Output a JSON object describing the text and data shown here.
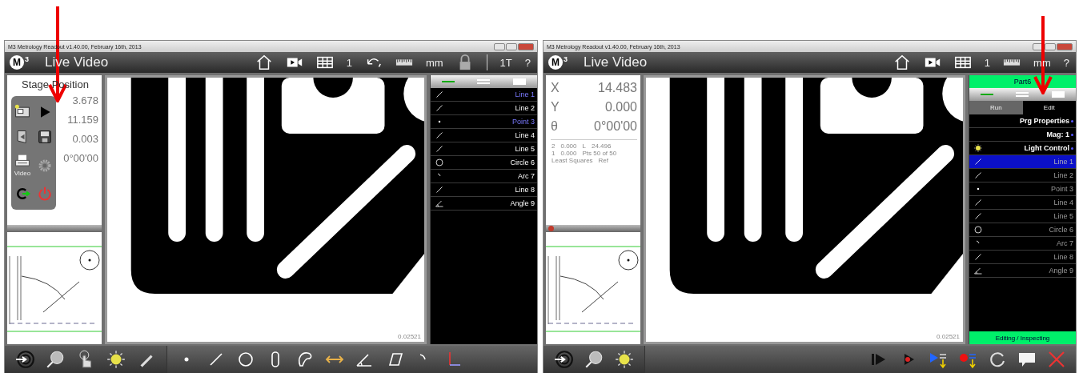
{
  "windows": [
    {
      "title": "M3 Metrology Readout  v1.40.00, February 16th, 2013",
      "logo": {
        "letter": "M",
        "superscript": "3"
      },
      "view_title": "Live Video",
      "header": [
        {
          "kind": "home"
        },
        {
          "kind": "video"
        },
        {
          "kind": "table"
        },
        {
          "kind": "text",
          "text": "1"
        },
        {
          "kind": "skew"
        },
        {
          "kind": "ruler"
        },
        {
          "kind": "text",
          "text": "mm"
        },
        {
          "kind": "lock"
        },
        {
          "kind": "divider"
        },
        {
          "kind": "text",
          "text": "1T"
        },
        {
          "kind": "text",
          "text": "?"
        }
      ],
      "readout": {
        "title": "Stage Position",
        "axes": [
          {
            "value": "3.678"
          },
          {
            "value": "11.159"
          },
          {
            "value": "0.003"
          },
          {
            "value": "0°00'00"
          }
        ]
      },
      "popup_menu": {
        "items": [
          {
            "kind": "display"
          },
          {
            "kind": "play"
          },
          {
            "kind": "door"
          },
          {
            "kind": "disk"
          },
          {
            "kind": "printer",
            "label": "Video"
          },
          {
            "kind": "gear"
          },
          {
            "kind": "restart"
          },
          {
            "kind": "power"
          }
        ]
      },
      "sketch": {
        "recording": false
      },
      "scale": "0.02521",
      "feature_list": {
        "rows": [
          {
            "kind": "line",
            "label": "Line 1",
            "selected": true
          },
          {
            "kind": "line",
            "label": "Line 2",
            "selected": false
          },
          {
            "kind": "point",
            "label": "Point 3",
            "selected": true
          },
          {
            "kind": "line",
            "label": "Line 4",
            "selected": false
          },
          {
            "kind": "line",
            "label": "Line 5",
            "selected": false
          },
          {
            "kind": "circle",
            "label": "Circle 6",
            "selected": false
          },
          {
            "kind": "arc",
            "label": "Arc 7",
            "selected": false
          },
          {
            "kind": "line",
            "label": "Line 8",
            "selected": false
          },
          {
            "kind": "angle",
            "label": "Angle 9",
            "selected": false
          }
        ]
      },
      "toolbar": {
        "primary": [
          {
            "kind": "target"
          },
          {
            "kind": "zoom"
          },
          {
            "kind": "hand"
          },
          {
            "kind": "light"
          },
          {
            "kind": "pencil"
          }
        ],
        "secondary": [
          {
            "kind": "point"
          },
          {
            "kind": "line"
          },
          {
            "kind": "circle"
          },
          {
            "kind": "slot"
          },
          {
            "kind": "blob"
          },
          {
            "kind": "distance"
          },
          {
            "kind": "angle"
          },
          {
            "kind": "parallelogram"
          },
          {
            "kind": "arc"
          },
          {
            "kind": "axes"
          }
        ]
      }
    },
    {
      "title": "M3 Metrology Readout  v1.40.00, February 16th, 2013",
      "logo": {
        "letter": "M",
        "superscript": "3"
      },
      "view_title": "Live Video",
      "header": [
        {
          "kind": "home"
        },
        {
          "kind": "video"
        },
        {
          "kind": "table"
        },
        {
          "kind": "text",
          "text": "1"
        },
        {
          "kind": "ruler"
        },
        {
          "kind": "text",
          "text": "mm"
        },
        {
          "kind": "text",
          "text": "?"
        }
      ],
      "readout": {
        "axes": [
          {
            "label": "X",
            "value": "14.483"
          },
          {
            "label": "Y",
            "value": "0.000"
          },
          {
            "label": "θ",
            "value": "0°00'00"
          }
        ],
        "details": [
          [
            "2",
            "0.000",
            "L",
            "24.496"
          ],
          [
            "1",
            "0.000",
            "Pts 50 of 50"
          ],
          [
            "Least Squares",
            "Ref"
          ]
        ]
      },
      "sketch": {
        "recording": true
      },
      "scale": "0.02521",
      "feature_list": {
        "part": "Part6",
        "tabs": [
          {
            "label": "Run",
            "selected": false
          },
          {
            "label": "Edit",
            "selected": true
          }
        ],
        "rows": [
          {
            "kind": "setting",
            "label": "Prg Properties",
            "selected": false
          },
          {
            "kind": "setting",
            "label": "Mag: 1",
            "selected": false
          },
          {
            "kind": "light",
            "label": "Light Control",
            "selected": false
          },
          {
            "kind": "line",
            "label": "Line 1",
            "selected": true
          },
          {
            "kind": "line",
            "label": "Line 2",
            "selected": false
          },
          {
            "kind": "point",
            "label": "Point 3",
            "selected": false
          },
          {
            "kind": "line",
            "label": "Line 4",
            "selected": false
          },
          {
            "kind": "line",
            "label": "Line 5",
            "selected": false
          },
          {
            "kind": "circle",
            "label": "Circle 6",
            "selected": false
          },
          {
            "kind": "arc",
            "label": "Arc 7",
            "selected": false
          },
          {
            "kind": "line",
            "label": "Line 8",
            "selected": false
          },
          {
            "kind": "angle",
            "label": "Angle 9",
            "selected": false
          }
        ],
        "status": "Editing / Inspecting"
      },
      "toolbar": {
        "primary": [
          {
            "kind": "target"
          },
          {
            "kind": "zoom"
          },
          {
            "kind": "light"
          }
        ],
        "secondary": [
          {
            "kind": "spacer"
          },
          {
            "kind": "step"
          },
          {
            "kind": "record-play"
          },
          {
            "kind": "insert-play"
          },
          {
            "kind": "insert-record"
          },
          {
            "kind": "refresh"
          },
          {
            "kind": "comment"
          },
          {
            "kind": "cancel"
          }
        ]
      }
    }
  ]
}
